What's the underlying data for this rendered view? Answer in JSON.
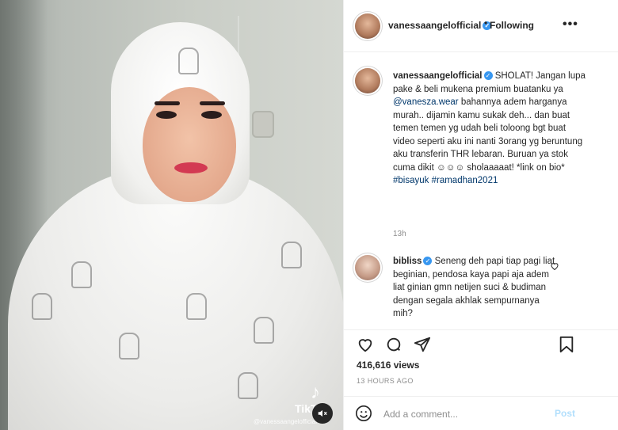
{
  "post": {
    "username": "vanessaangelofficial",
    "separator": "•",
    "follow_status": "Following",
    "more_label": "•••"
  },
  "caption": {
    "author": "vanessaangelofficial",
    "text_1": " SHOLAT! Jangan lupa pake & beli mukena premium buatanku ya ",
    "mention": "@vanesza.wear",
    "text_2": " bahannya adem harganya murah.. dijamin kamu sukak deh... dan buat temen temen yg udah beli toloong bgt buat video seperti aku ini nanti 3orang yg beruntung aku transferin THR lebaran. Buruan ya stok cuma dikit ☺☺☺ sholaaaaat! *link on bio* ",
    "hashtag_1": "#bisayuk",
    "hashtag_2": "#ramadhan2021",
    "time": "13h"
  },
  "comment": {
    "author": "bibliss",
    "text": " Seneng deh papi tiap pagi liat beginian, pendosa kaya papi aja adem liat ginian gmn netijen suci & budiman dengan segala akhlak sempurnanya mih?"
  },
  "stats": {
    "views": "416,616 views",
    "time_ago": "13 HOURS AGO"
  },
  "add_comment": {
    "placeholder": "Add a comment...",
    "post_label": "Post"
  },
  "overlay": {
    "tiktok_label": "TikTok",
    "tiktok_handle": "@vanessaangelofficial"
  },
  "colors": {
    "link": "#00376b",
    "verified": "#3897f0",
    "muted": "#8e8e8e",
    "post_disabled": "#b2dffc"
  }
}
